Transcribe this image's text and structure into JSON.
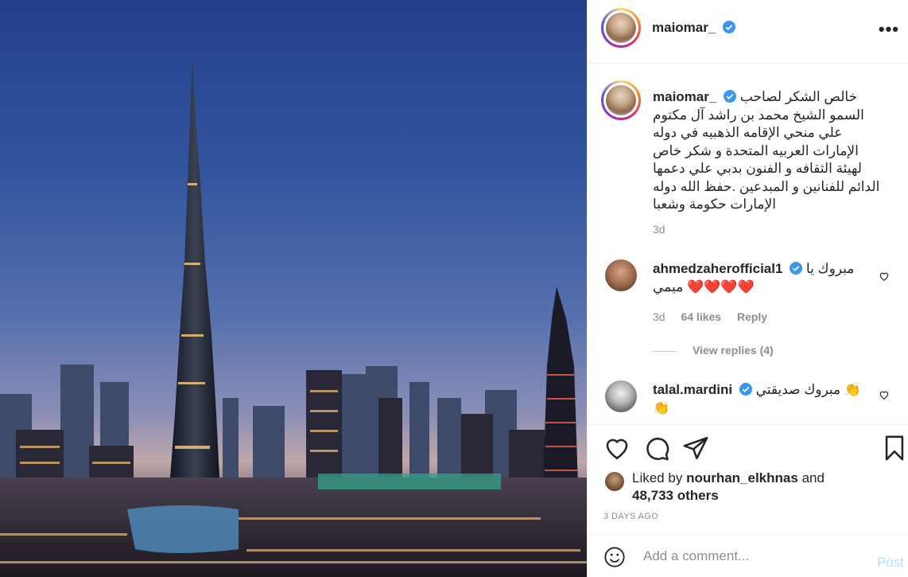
{
  "post": {
    "username": "maiomar_",
    "more_icon": "more-horizontal-icon",
    "caption": "خالص الشكر لصاحب السمو الشيخ محمد بن راشد آل مكتوم علي منحي الإقامه الذهبيه في دوله الإمارات العربيه المتحدة و شكر خاص لهيئة الثقافه و الفنون بدبي علي دعمها الدائم للفنانين و المبدعين .حفظ الله دوله الإمارات حكومة وشعبا",
    "caption_time": "3d"
  },
  "comments": [
    {
      "username": "ahmedzaherofficial1",
      "text": "مبروك يا ❤️❤️❤️❤️ ميمي",
      "time": "3d",
      "likes": "64 likes",
      "reply": "Reply",
      "view_replies": "View replies (4)"
    },
    {
      "username": "talal.mardini",
      "text": "مبروك صديقتي 👏 👏"
    }
  ],
  "actions": {
    "like_icon": "heart-icon",
    "comment_icon": "comment-icon",
    "share_icon": "paper-plane-icon",
    "save_icon": "bookmark-icon"
  },
  "likes": {
    "prefix": "Liked by",
    "user": "nourhan_elkhnas",
    "and": "and",
    "others": "48,733 others"
  },
  "date": "3 DAYS AGO",
  "add_comment": {
    "placeholder": "Add a comment...",
    "post_label": "Post",
    "emoji_icon": "smiley-icon"
  },
  "colors": {
    "verified": "#3897f0",
    "heart_red": "#ed4956",
    "post_disabled": "#b2dffc",
    "muted": "#8e8e8e"
  }
}
